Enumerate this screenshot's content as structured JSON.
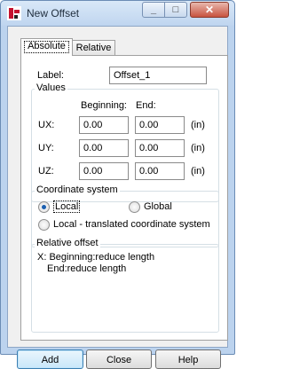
{
  "window": {
    "title": "New Offset"
  },
  "tabs": [
    {
      "label": "Absolute"
    },
    {
      "label": "Relative"
    }
  ],
  "label_field": {
    "label": "Label:",
    "value": "Offset_1"
  },
  "values": {
    "group_label": "Values",
    "col_beginning": "Beginning:",
    "col_end": "End:",
    "rows": [
      {
        "name": "UX:",
        "beginning": "0.00",
        "end": "0.00",
        "unit": "(in)"
      },
      {
        "name": "UY:",
        "beginning": "0.00",
        "end": "0.00",
        "unit": "(in)"
      },
      {
        "name": "UZ:",
        "beginning": "0.00",
        "end": "0.00",
        "unit": "(in)"
      }
    ]
  },
  "coordinate_system": {
    "group_label": "Coordinate system",
    "options": [
      {
        "label": "Local",
        "selected": true
      },
      {
        "label": "Global",
        "selected": false
      },
      {
        "label": "Local - translated coordinate system",
        "selected": false
      }
    ]
  },
  "relative_offset": {
    "group_label": "Relative offset",
    "line1": "X: Beginning:reduce length",
    "line2": "End:reduce length"
  },
  "buttons": {
    "add": "Add",
    "close": "Close",
    "help": "Help"
  },
  "colors": {
    "accent": "#1b5fb0",
    "close_button": "#c8533f"
  }
}
